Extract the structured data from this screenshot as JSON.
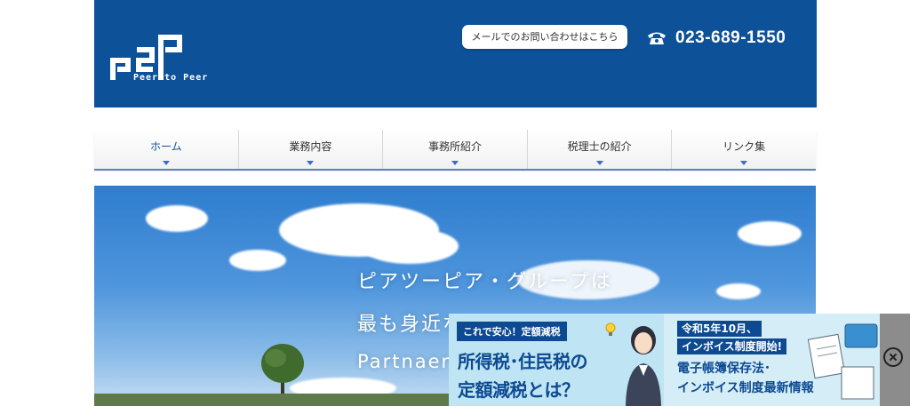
{
  "header": {
    "logo_text": "P2P",
    "logo_subtitle": "Peer to Peer",
    "mail_button": "メールでのお問い合わせはこちら",
    "phone_icon": "telephone-icon",
    "phone_number": "023-689-1550",
    "brand_color": "#0d5199"
  },
  "nav": {
    "items": [
      {
        "label": "ホーム"
      },
      {
        "label": "業務内容"
      },
      {
        "label": "事務所紹介"
      },
      {
        "label": "税理士の紹介"
      },
      {
        "label": "リンク集"
      }
    ],
    "active_index": 0
  },
  "hero": {
    "line1": "ピアツーピア・グループは",
    "line2": "最も身近な",
    "line3": "Partnaer"
  },
  "banner": {
    "tag_left": "これで安心！定額減税",
    "headline1": "所得税･住民税の",
    "headline2": "定額減税とは？",
    "tag_right_1": "令和5年10月、",
    "tag_right_2": "インボイス制度開始!",
    "headline3_1": "電子帳簿保存法･",
    "headline3_2": "インボイス制度最新情報",
    "close_icon": "close-icon"
  }
}
